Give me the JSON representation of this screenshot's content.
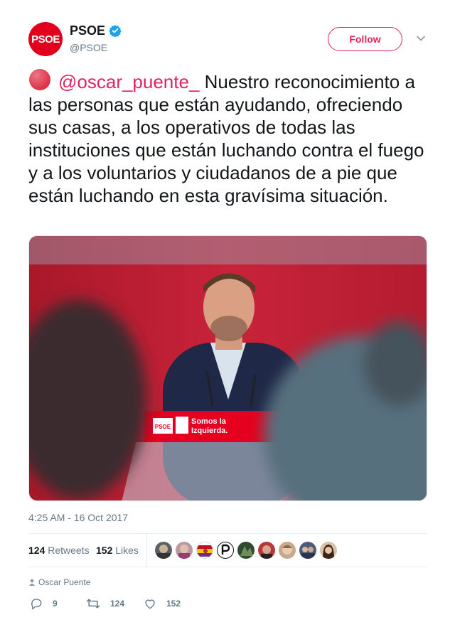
{
  "author": {
    "avatar_text": "PSOE",
    "display_name": "PSOE",
    "handle": "@PSOE",
    "follow_label": "Follow"
  },
  "tweet": {
    "mention": "@oscar_puente_",
    "text": " Nuestro reconocimiento a las personas que están ayudando, ofreciendo sus casas, a los operativos de todas las instituciones que están luchando contra el fuego y a los voluntarios y ciudadanos de a pie que están luchando en esta gravísima situación.",
    "photo": {
      "podium_logo": "PSOE",
      "podium_slogan_line1": "Somos la",
      "podium_slogan_line2": "Izquierda."
    },
    "timestamp": "4:25 AM - 16 Oct 2017"
  },
  "stats": {
    "retweets_count": "124",
    "retweets_label": "Retweets",
    "likes_count": "152",
    "likes_label": "Likes"
  },
  "attribution": "Oscar Puente",
  "actions": {
    "replies": "9",
    "retweets": "124",
    "likes": "152"
  },
  "colors": {
    "brand_red": "#e1001e",
    "like_pink": "#e0245e",
    "verified_blue": "#1da1f2",
    "muted": "#657786"
  }
}
